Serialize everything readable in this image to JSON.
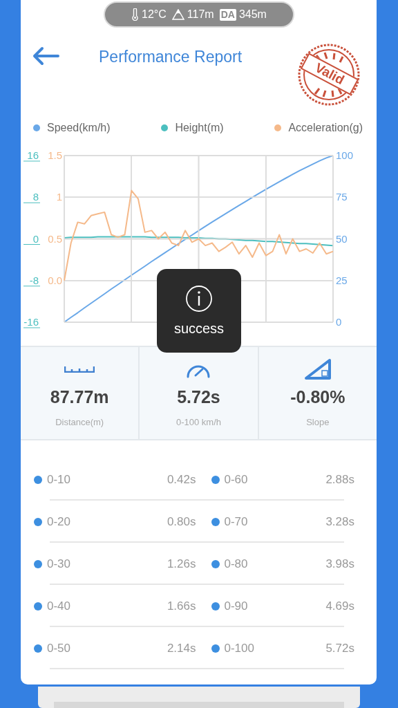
{
  "status_pill": {
    "temperature": "12°C",
    "altitude": "117m",
    "da_badge": "DA",
    "density_altitude": "345m"
  },
  "header": {
    "title": "Performance Report",
    "stamp": "Valid"
  },
  "chart": {
    "speed": {
      "chart_data": {
        "type": "line",
        "categories": [
          null,
          null,
          null,
          null,
          null,
          null,
          null,
          null,
          null,
          null,
          null,
          null,
          null,
          null,
          null,
          null,
          null,
          null,
          null,
          null,
          null,
          null,
          null,
          null,
          null,
          null,
          null,
          null,
          null,
          null,
          null,
          null,
          null,
          null,
          null,
          null,
          null,
          null,
          null,
          null,
          null
        ],
        "ylim": [
          0,
          100
        ],
        "grid": true,
        "yticks": [
          0,
          25,
          50,
          75,
          100
        ],
        "series": [
          {
            "name": "Speed(km/h)",
            "color": "#6aa8e8",
            "values": [
              0,
              2.9,
              5.7,
              8.6,
              11.4,
              14.2,
              17.0,
              19.9,
              22.6,
              25.4,
              28.2,
              30.9,
              33.6,
              36.4,
              39.1,
              41.8,
              44.4,
              47.1,
              49.7,
              52.3,
              54.9,
              57.5,
              60.1,
              62.6,
              65.1,
              67.6,
              70.1,
              72.5,
              75.0,
              77.3,
              79.7,
              82.0,
              84.3,
              86.5,
              88.7,
              90.9,
              92.9,
              94.9,
              96.8,
              98.6,
              100
            ]
          }
        ]
      }
    },
    "height": {
      "chart_data": {
        "type": "line",
        "categories": [
          null,
          null,
          null,
          null,
          null,
          null,
          null,
          null,
          null,
          null,
          null,
          null,
          null,
          null,
          null,
          null,
          null,
          null,
          null,
          null,
          null,
          null,
          null,
          null,
          null,
          null,
          null,
          null,
          null,
          null,
          null,
          null,
          null,
          null,
          null,
          null,
          null,
          null,
          null,
          null,
          null
        ],
        "ylim": [
          -16,
          16
        ],
        "grid": true,
        "yticks": [
          -16,
          -8,
          0,
          8,
          16
        ],
        "series": [
          {
            "name": "Height(m)",
            "color": "#4cbfbf",
            "values": [
              0.2,
              0.3,
              0.3,
              0.3,
              0.3,
              0.4,
              0.4,
              0.4,
              0.4,
              0.4,
              0.4,
              0.4,
              0.4,
              0.3,
              0.3,
              0.3,
              0.3,
              0.3,
              0.2,
              0.2,
              0.2,
              0.1,
              0.1,
              0,
              0,
              -0.1,
              -0.2,
              -0.3,
              -0.3,
              -0.4,
              -0.5,
              -0.5,
              -0.6,
              -0.7,
              -0.8,
              -0.9,
              -0.9,
              -1.0,
              -1.1,
              -1.2,
              -1.3
            ]
          }
        ]
      }
    },
    "acceleration": {
      "chart_data": {
        "type": "line",
        "categories": [
          null,
          null,
          null,
          null,
          null,
          null,
          null,
          null,
          null,
          null,
          null,
          null,
          null,
          null,
          null,
          null,
          null,
          null,
          null,
          null,
          null,
          null,
          null,
          null,
          null,
          null,
          null,
          null,
          null,
          null,
          null,
          null,
          null,
          null,
          null,
          null,
          null,
          null,
          null,
          null,
          null
        ],
        "ylim": [
          -0.5,
          1.5
        ],
        "grid": true,
        "yticks": [
          {
            "value": 0,
            "label": "0.0"
          },
          {
            "value": 0.5,
            "label": "0.5"
          },
          {
            "value": 1,
            "label": "1"
          },
          {
            "value": 1.5,
            "label": "1.5"
          }
        ],
        "series": [
          {
            "name": "Acceleration(g)",
            "color": "#f5b98a",
            "values": [
              0,
              0.45,
              0.7,
              0.68,
              0.78,
              0.8,
              0.82,
              0.55,
              0.52,
              0.55,
              1.08,
              0.98,
              0.58,
              0.6,
              0.5,
              0.58,
              0.45,
              0.42,
              0.6,
              0.46,
              0.5,
              0.42,
              0.45,
              0.35,
              0.4,
              0.46,
              0.32,
              0.42,
              0.28,
              0.45,
              0.3,
              0.35,
              0.55,
              0.32,
              0.5,
              0.35,
              0.38,
              0.33,
              0.45,
              0.32,
              0.35
            ]
          }
        ]
      }
    }
  },
  "toast": {
    "text": "success"
  },
  "stats": [
    {
      "kind": "distance",
      "value": "87.77m",
      "label": "Distance(m)"
    },
    {
      "kind": "time",
      "value": "5.72s",
      "label": "0-100 km/h"
    },
    {
      "kind": "slope",
      "value": "-0.80%",
      "label": "Slope"
    }
  ],
  "splits": [
    {
      "range": "0-10",
      "time": "0.42s"
    },
    {
      "range": "0-60",
      "time": "2.88s"
    },
    {
      "range": "0-20",
      "time": "0.80s"
    },
    {
      "range": "0-70",
      "time": "3.28s"
    },
    {
      "range": "0-30",
      "time": "1.26s"
    },
    {
      "range": "0-80",
      "time": "3.98s"
    },
    {
      "range": "0-40",
      "time": "1.66s"
    },
    {
      "range": "0-90",
      "time": "4.69s"
    },
    {
      "range": "0-50",
      "time": "2.14s"
    },
    {
      "range": "0-100",
      "time": "5.72s"
    }
  ]
}
